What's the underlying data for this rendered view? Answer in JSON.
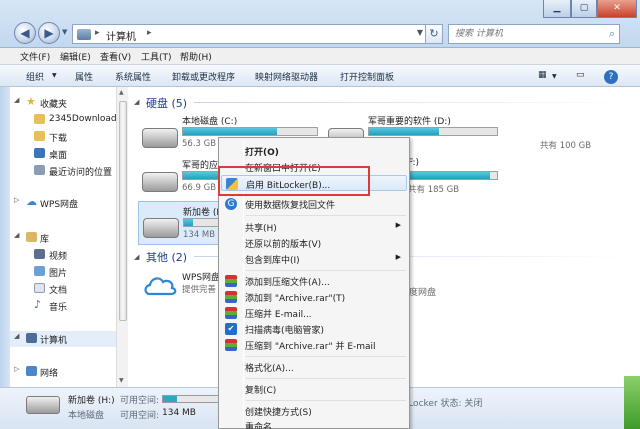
{
  "window": {
    "address_path": "计算机",
    "search_placeholder": "搜索 计算机",
    "min_label": "▁",
    "max_label": "▢",
    "close_label": "✕"
  },
  "menubar": {
    "items": [
      "文件(F)",
      "编辑(E)",
      "查看(V)",
      "工具(T)",
      "帮助(H)"
    ]
  },
  "toolbar": {
    "items": [
      "组织",
      "属性",
      "系统属性",
      "卸载或更改程序",
      "映射网络驱动器",
      "打开控制面板"
    ]
  },
  "navpane": {
    "favorites": "收藏夹",
    "fav_items": [
      "2345Download",
      "下载",
      "桌面",
      "最近访问的位置"
    ],
    "wps": "WPS网盘",
    "library": "库",
    "lib_items": [
      "视频",
      "图片",
      "文档",
      "音乐"
    ],
    "computer": "计算机",
    "network": "网络"
  },
  "content": {
    "hdd_header": "硬盘 (5)",
    "other_header": "其他 (2)",
    "drives": [
      {
        "name": "本地磁盘 (C:)",
        "free": "56.3 GB",
        "fill": 0.7
      },
      {
        "name": "军哥重要的软件 (D:)",
        "free": "共有 100 GB",
        "fill": 0.55
      },
      {
        "name": "军哥的应",
        "free": "66.9 GB",
        "fill": 0.45
      },
      {
        "name": "F:)",
        "free": "共有 185 GB",
        "fill": 0.92
      },
      {
        "name": "新加卷 (H",
        "free": "134 MB",
        "fill": 0.25
      }
    ],
    "other_items": [
      {
        "name": "WPS网盘",
        "sub": "提供完善"
      },
      {
        "name": "百度网盘",
        "sub": ""
      }
    ]
  },
  "status": {
    "drive_name": "新加卷 (H:)",
    "type": "本地磁盘",
    "avail_label": "可用空间:",
    "avail_label2": "可用空间:",
    "avail_value": "134 MB",
    "bitlocker": "BitLocker 状态: 关闭"
  },
  "context_menu": {
    "items": [
      {
        "label": "打开(O)",
        "bold": true
      },
      {
        "label": "在新窗口中打开(E)"
      },
      {
        "label": "启用 BitLocker(B)..."
      },
      {
        "label": "使用数据恢复找回文件"
      },
      {
        "label": "共享(H)",
        "sub": true
      },
      {
        "label": "还原以前的版本(V)"
      },
      {
        "label": "包含到库中(I)",
        "sub": true
      },
      {
        "label": "添加到压缩文件(A)..."
      },
      {
        "label": "添加到 \"Archive.rar\"(T)"
      },
      {
        "label": "压缩并 E-mail..."
      },
      {
        "label": "扫描病毒(电脑管家)"
      },
      {
        "label": "压缩到 \"Archive.rar\" 并 E-mail"
      },
      {
        "label": "格式化(A)..."
      },
      {
        "label": "复制(C)"
      },
      {
        "label": "创建快捷方式(S)"
      },
      {
        "label": "重命名"
      }
    ]
  },
  "colors": {
    "accent": "#21a0c0",
    "highlight_box": "#e0393a",
    "header_text": "#1e3f8a"
  }
}
